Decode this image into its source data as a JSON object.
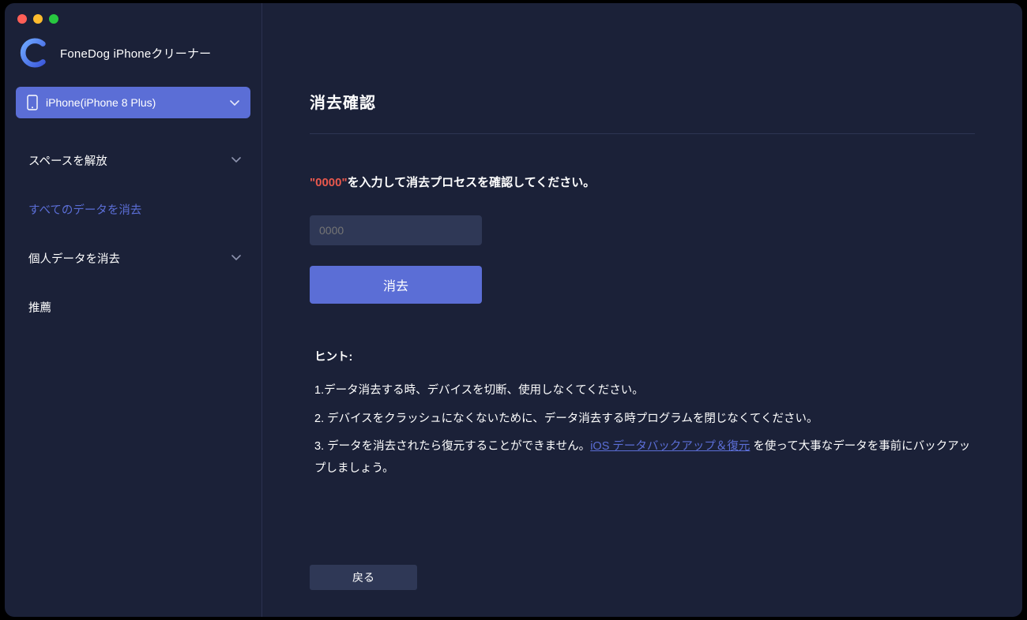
{
  "app": {
    "title": "FoneDog iPhoneクリーナー"
  },
  "device": {
    "label": "iPhone(iPhone 8 Plus)"
  },
  "sidebar": {
    "items": [
      {
        "label": "スペースを解放",
        "expandable": true
      },
      {
        "label": "すべてのデータを消去",
        "active": true
      },
      {
        "label": "個人データを消去",
        "expandable": true
      },
      {
        "label": "推薦"
      }
    ]
  },
  "main": {
    "title": "消去確認",
    "prompt_code": "\"0000\"",
    "prompt_rest": "を入力して消去プロセスを確認してください。",
    "input_placeholder": "0000",
    "erase_button": "消去",
    "hints_title": "ヒント:",
    "hints": {
      "h1": "1.データ消去する時、デバイスを切断、使用しなくてください。",
      "h2": "2. デバイスをクラッシュになくないために、データ消去する時プログラムを閉じなくてください。",
      "h3_pre": "3. データを消去されたら復元することができません。",
      "h3_link": "iOS データバックアップ＆復元",
      "h3_post": " を使って大事なデータを事前にバックアップしましょう。"
    },
    "back_button": "戻る"
  }
}
